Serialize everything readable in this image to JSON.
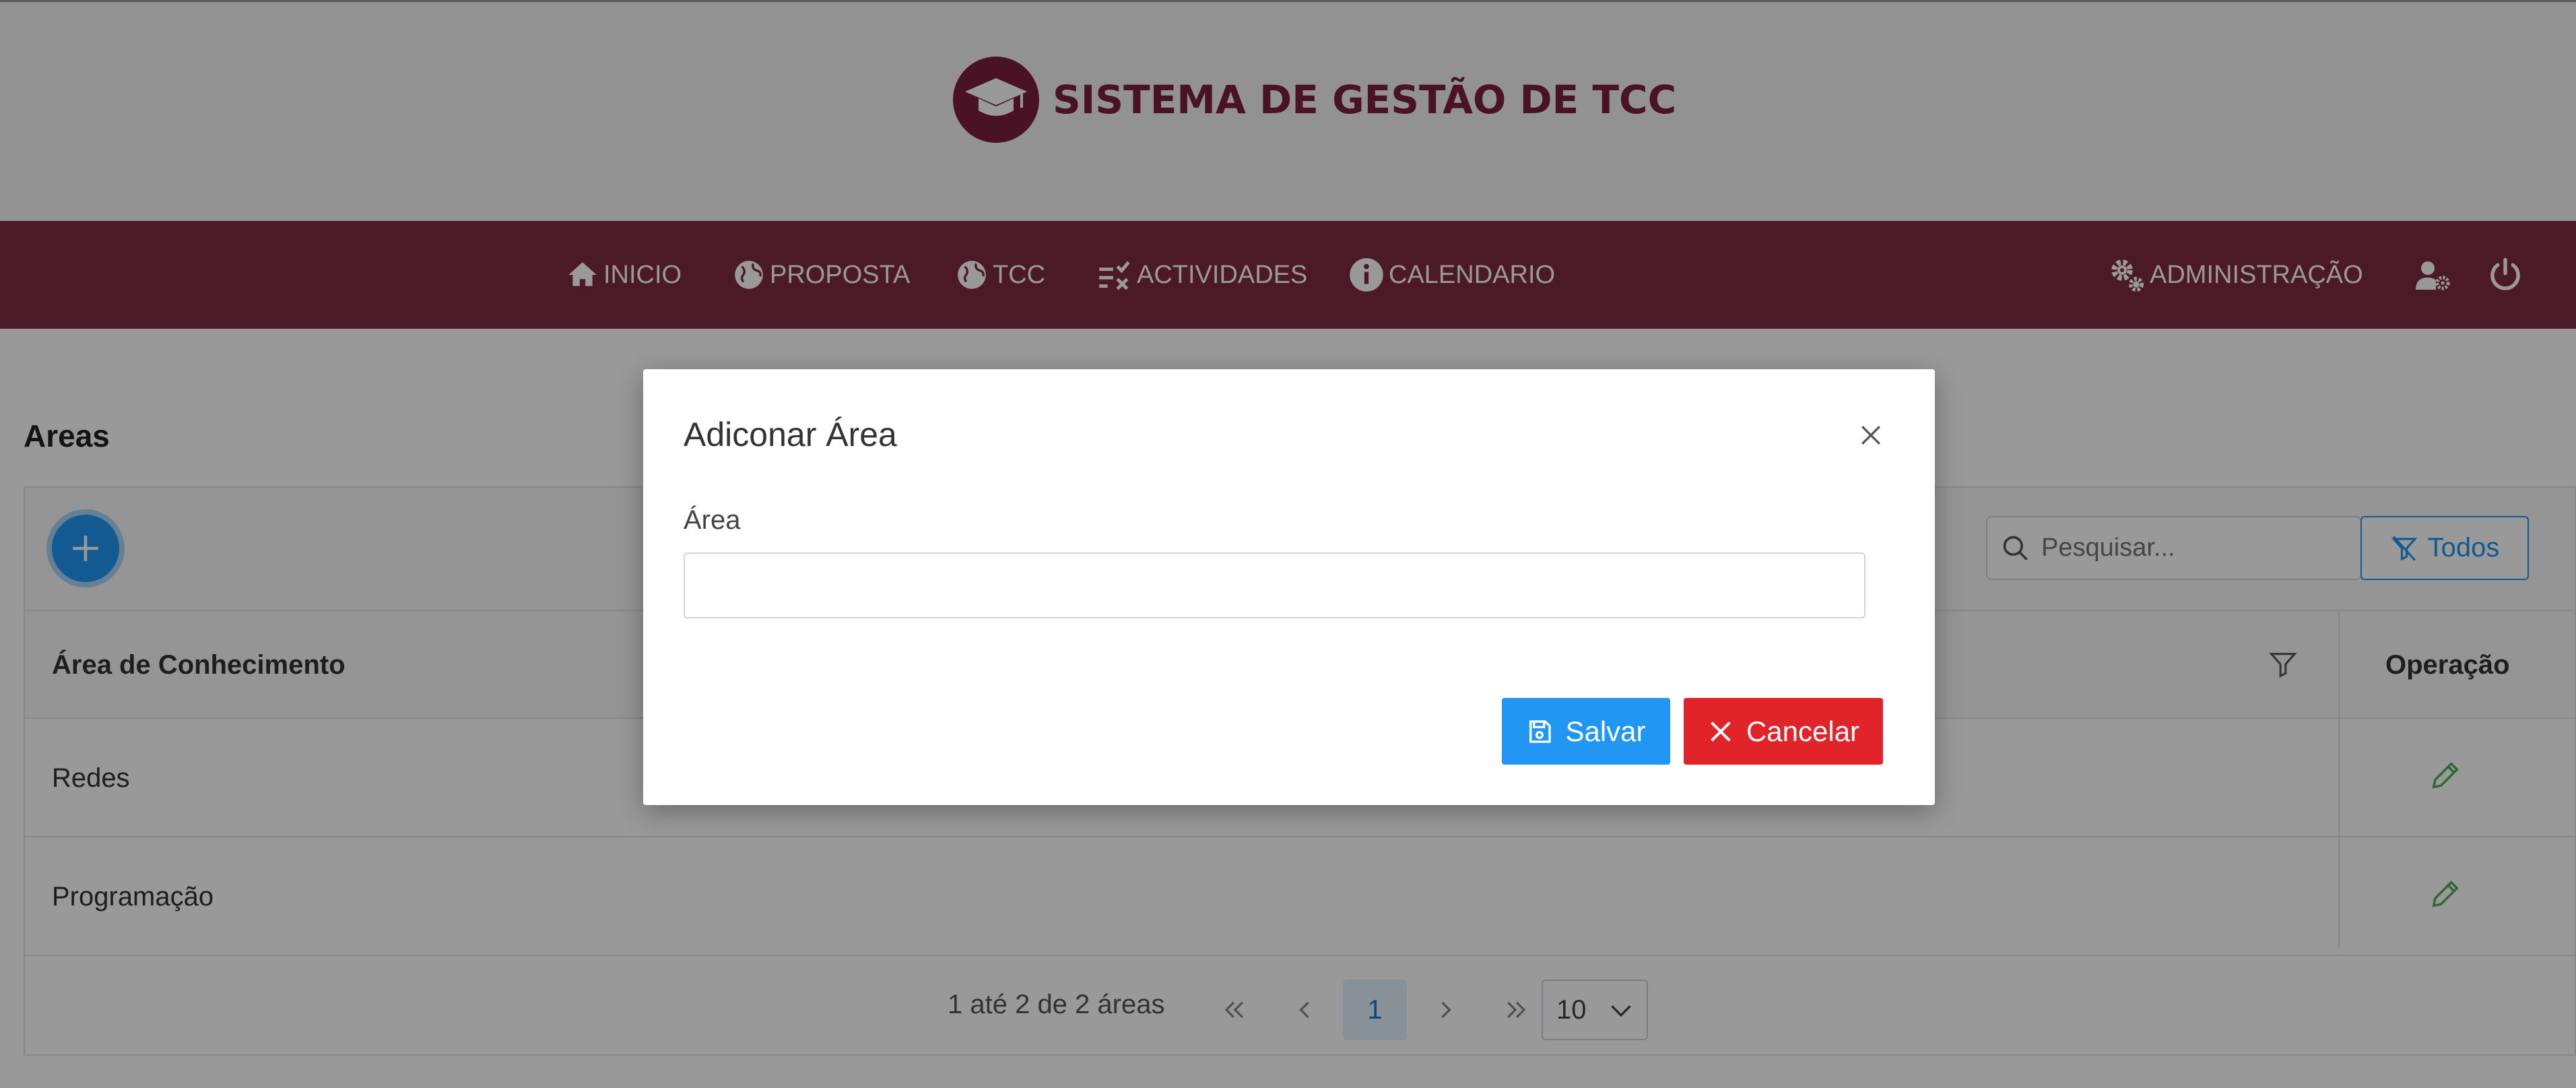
{
  "header": {
    "brand_title": "SISTEMA DE GESTÃO DE TCC",
    "brand_color": "#7b1f3e"
  },
  "navbar": {
    "background": "#7d2a43",
    "items": [
      {
        "label": "INICIO",
        "icon": "home-icon"
      },
      {
        "label": "PROPOSTA",
        "icon": "globe-icon"
      },
      {
        "label": "TCC",
        "icon": "globe-icon"
      },
      {
        "label": "ACTIVIDADES",
        "icon": "checklist-icon"
      },
      {
        "label": "CALENDARIO",
        "icon": "info-icon"
      }
    ],
    "admin_label": "ADMINISTRAÇÃO",
    "right_icons": [
      "user-settings-icon",
      "power-icon"
    ]
  },
  "page": {
    "title": "Areas"
  },
  "toolbar": {
    "search_placeholder": "Pesquisar...",
    "filter_label": "Todos"
  },
  "table": {
    "columns": [
      "Área de Conhecimento",
      "Operação"
    ],
    "rows": [
      {
        "area": "Redes"
      },
      {
        "area": "Programação"
      }
    ]
  },
  "pagination": {
    "summary": "1 até 2 de 2 áreas",
    "current_page": "1",
    "rows_per_page": "10"
  },
  "modal": {
    "title": "Adiconar Área",
    "field_label": "Área",
    "field_value": "",
    "save_label": "Salvar",
    "cancel_label": "Cancelar"
  },
  "colors": {
    "primary": "#2196f3",
    "danger": "#e0242a",
    "edit": "#4caf50"
  }
}
